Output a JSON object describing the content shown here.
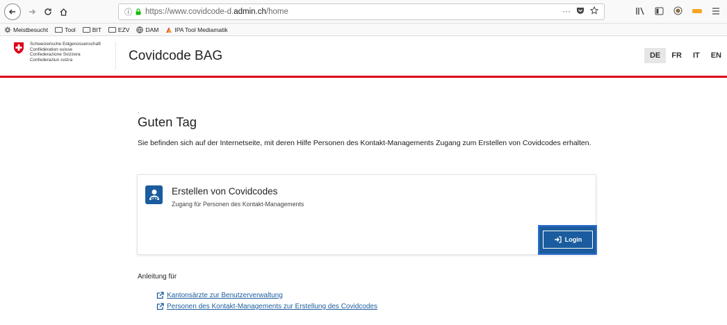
{
  "browser": {
    "url_prefix": "https://www.covidcode-d.",
    "url_domain": "admin.ch",
    "url_suffix": "/home",
    "url_more": "···",
    "bookmarks": [
      {
        "label": "Meistbesucht",
        "icon": "gear-icon"
      },
      {
        "label": "Tool",
        "icon": "folder-icon"
      },
      {
        "label": "BIT",
        "icon": "folder-icon"
      },
      {
        "label": "EZV",
        "icon": "folder-icon"
      },
      {
        "label": "DAM",
        "icon": "globe-icon"
      },
      {
        "label": "IPA Tool Mediamatik",
        "icon": "mediamatik-icon"
      }
    ]
  },
  "header": {
    "confederation": [
      "Schweizerische Eidgenossenschaft",
      "Confédération suisse",
      "Confederazione Svizzera",
      "Confederaziun svizra"
    ],
    "title": "Covidcode BAG",
    "languages": [
      "DE",
      "FR",
      "IT",
      "EN"
    ],
    "active_language": "DE",
    "accent_color": "#dc0018"
  },
  "main": {
    "dot": ".",
    "greeting": "Guten Tag",
    "intro": "Sie befinden sich auf der Internetseite, mit deren Hilfe Personen des Kontakt-Managements Zugang zum Erstellen von Covidcodes erhalten.",
    "card": {
      "title": "Erstellen von Covidcodes",
      "subtitle": "Zugang für Personen des Kontakt-Managements",
      "login_label": "Login",
      "icon": "user-id-icon",
      "brand_color": "#1a5c9e"
    },
    "guide": {
      "label": "Anleitung für",
      "links": [
        "Kantonsärzte zur Benutzerverwaltung",
        "Personen des Kontakt-Managements zur Erstellung des Covidcodes"
      ]
    }
  }
}
